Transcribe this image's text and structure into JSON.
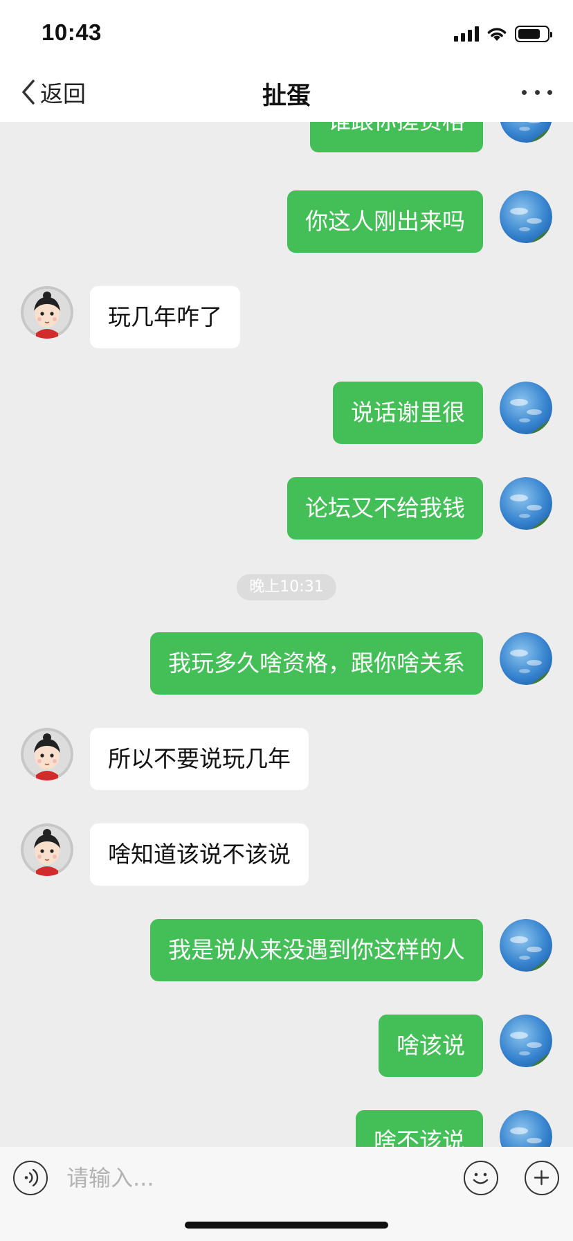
{
  "status_bar": {
    "time": "10:43"
  },
  "nav": {
    "back_label": "返回",
    "title": "扯蛋"
  },
  "chat": {
    "messages": [
      {
        "from": "me",
        "text": "谁跟你搓资格"
      },
      {
        "from": "me",
        "text": "你这人刚出来吗"
      },
      {
        "from": "other",
        "text": "玩几年咋了"
      },
      {
        "from": "me",
        "text": "说话谢里很"
      },
      {
        "from": "me",
        "text": "论坛又不给我钱"
      },
      {
        "from": "me",
        "text": "我玩多久啥资格，跟你啥关系"
      },
      {
        "from": "other",
        "text": "所以不要说玩几年"
      },
      {
        "from": "other",
        "text": "啥知道该说不该说"
      },
      {
        "from": "me",
        "text": "我是说从来没遇到你这样的人"
      },
      {
        "from": "me",
        "text": "啥该说"
      },
      {
        "from": "me",
        "text": "啥不该说"
      }
    ],
    "timestamp": "晚上10:31"
  },
  "input": {
    "placeholder": "请输入..."
  },
  "colors": {
    "my_bubble": "#44bf57",
    "their_bubble": "#ffffff",
    "chat_bg": "#ededed"
  }
}
